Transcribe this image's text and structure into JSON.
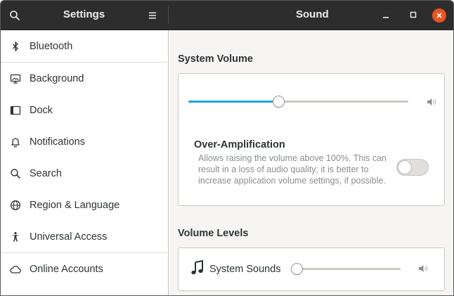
{
  "window": {
    "sidebar_title": "Settings",
    "main_title": "Sound",
    "accent": "#e95420",
    "slider_color": "#19a9e1"
  },
  "sidebar": {
    "items": [
      {
        "label": "Bluetooth",
        "icon": "bluetooth-icon"
      },
      {
        "label": "Background",
        "icon": "monitor-icon"
      },
      {
        "label": "Dock",
        "icon": "dock-icon"
      },
      {
        "label": "Notifications",
        "icon": "bell-icon"
      },
      {
        "label": "Search",
        "icon": "search-icon"
      },
      {
        "label": "Region & Language",
        "icon": "globe-icon"
      },
      {
        "label": "Universal Access",
        "icon": "accessibility-icon"
      },
      {
        "label": "Online Accounts",
        "icon": "cloud-icon"
      }
    ]
  },
  "system_volume": {
    "title": "System Volume",
    "level_fraction": 0.41,
    "over_amplification": {
      "title": "Over-Amplification",
      "description": "Allows raising the volume above 100%. This can result in a loss of audio quality; it is better to increase application volume settings, if possible.",
      "enabled": false
    }
  },
  "volume_levels": {
    "title": "Volume Levels",
    "system_sounds": {
      "label": "System Sounds",
      "level_fraction": 0.0
    }
  }
}
